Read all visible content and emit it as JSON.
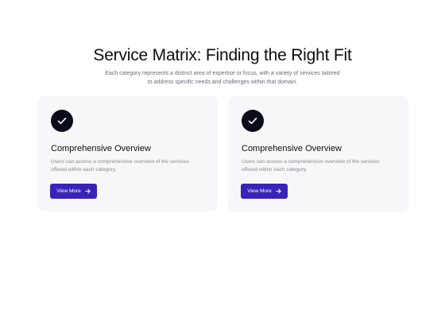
{
  "header": {
    "title": "Service Matrix: Finding the Right Fit",
    "subtitle": "Each category represents a distinct area of expertise or focus, with a variety of services tailored to address specific needs and challenges within that domain."
  },
  "cards": [
    {
      "icon": "check-icon",
      "title": "Comprehensive Overview",
      "description": "Users can access a comprehensive overview of the services offered within each category.",
      "button_label": "View More",
      "button_icon": "arrow-right-icon"
    },
    {
      "icon": "check-icon",
      "title": "Comprehensive Overview",
      "description": "Users can access a comprehensive overview of the services offered within each category.",
      "button_label": "View More",
      "button_icon": "arrow-right-icon"
    }
  ],
  "colors": {
    "accent": "#3a24b8",
    "icon_bg": "#0b0b1a",
    "card_bg": "#f7f7f9"
  }
}
